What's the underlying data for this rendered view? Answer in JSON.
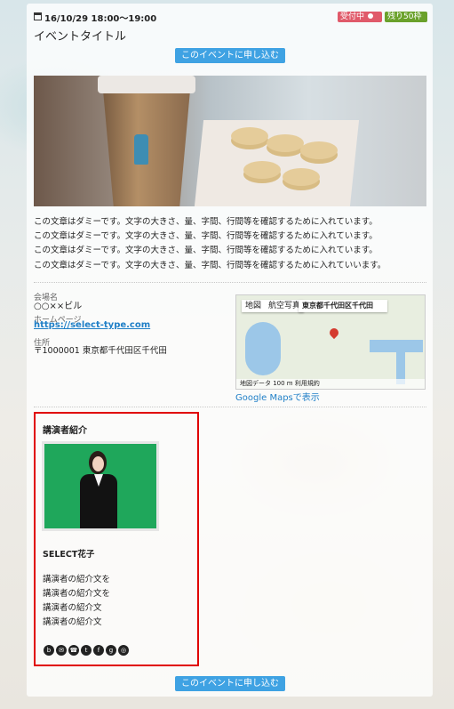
{
  "event": {
    "date": "16/10/29 18:00～19:00",
    "status_badge": "受付中",
    "remaining_badge": "残り50枠",
    "title": "イベントタイトル",
    "apply_button": "このイベントに申し込む"
  },
  "description": [
    "この文章はダミーです。文字の大きさ、量、字間、行間等を確認するために入れています。",
    "この文章はダミーです。文字の大きさ、量、字間、行間等を確認するために入れています。",
    "この文章はダミーです。文字の大きさ、量、字間、行間等を確認するために入れています。",
    "この文章はダミーです。文字の大きさ、量、字間、行間等を確認するために入れていいます。"
  ],
  "venue": {
    "venue_label": "会場名",
    "venue_value": "○○××ビル",
    "homepage_label": "ホームページ",
    "homepage_link": "https://select-type.com",
    "address_label": "住所",
    "address_value": "〒1000001 東京都千代田区千代田"
  },
  "map": {
    "tab_map": "地図",
    "tab_satellite": "航空写真",
    "address_box": "東京都千代田区千代田",
    "footer": "地図データ 100 m 利用規約",
    "view_link": "Google Mapsで表示"
  },
  "speaker": {
    "section_title": "講演者紹介",
    "name": "SELECT花子",
    "bio": [
      "講演者の紹介文を",
      "講演者の紹介文を",
      "講演者の紹介文",
      "講演者の紹介文"
    ],
    "social_icons": [
      "blog-icon",
      "mail-icon",
      "phone-icon",
      "twitter-icon",
      "facebook-icon",
      "google-plus-icon",
      "instagram-icon"
    ]
  },
  "colors": {
    "apply_button": "#3fa2e3",
    "status_badge": "#e05a6a",
    "remaining_badge": "#6aa12b",
    "speaker_border": "#e00000",
    "link": "#1f7fc7"
  }
}
